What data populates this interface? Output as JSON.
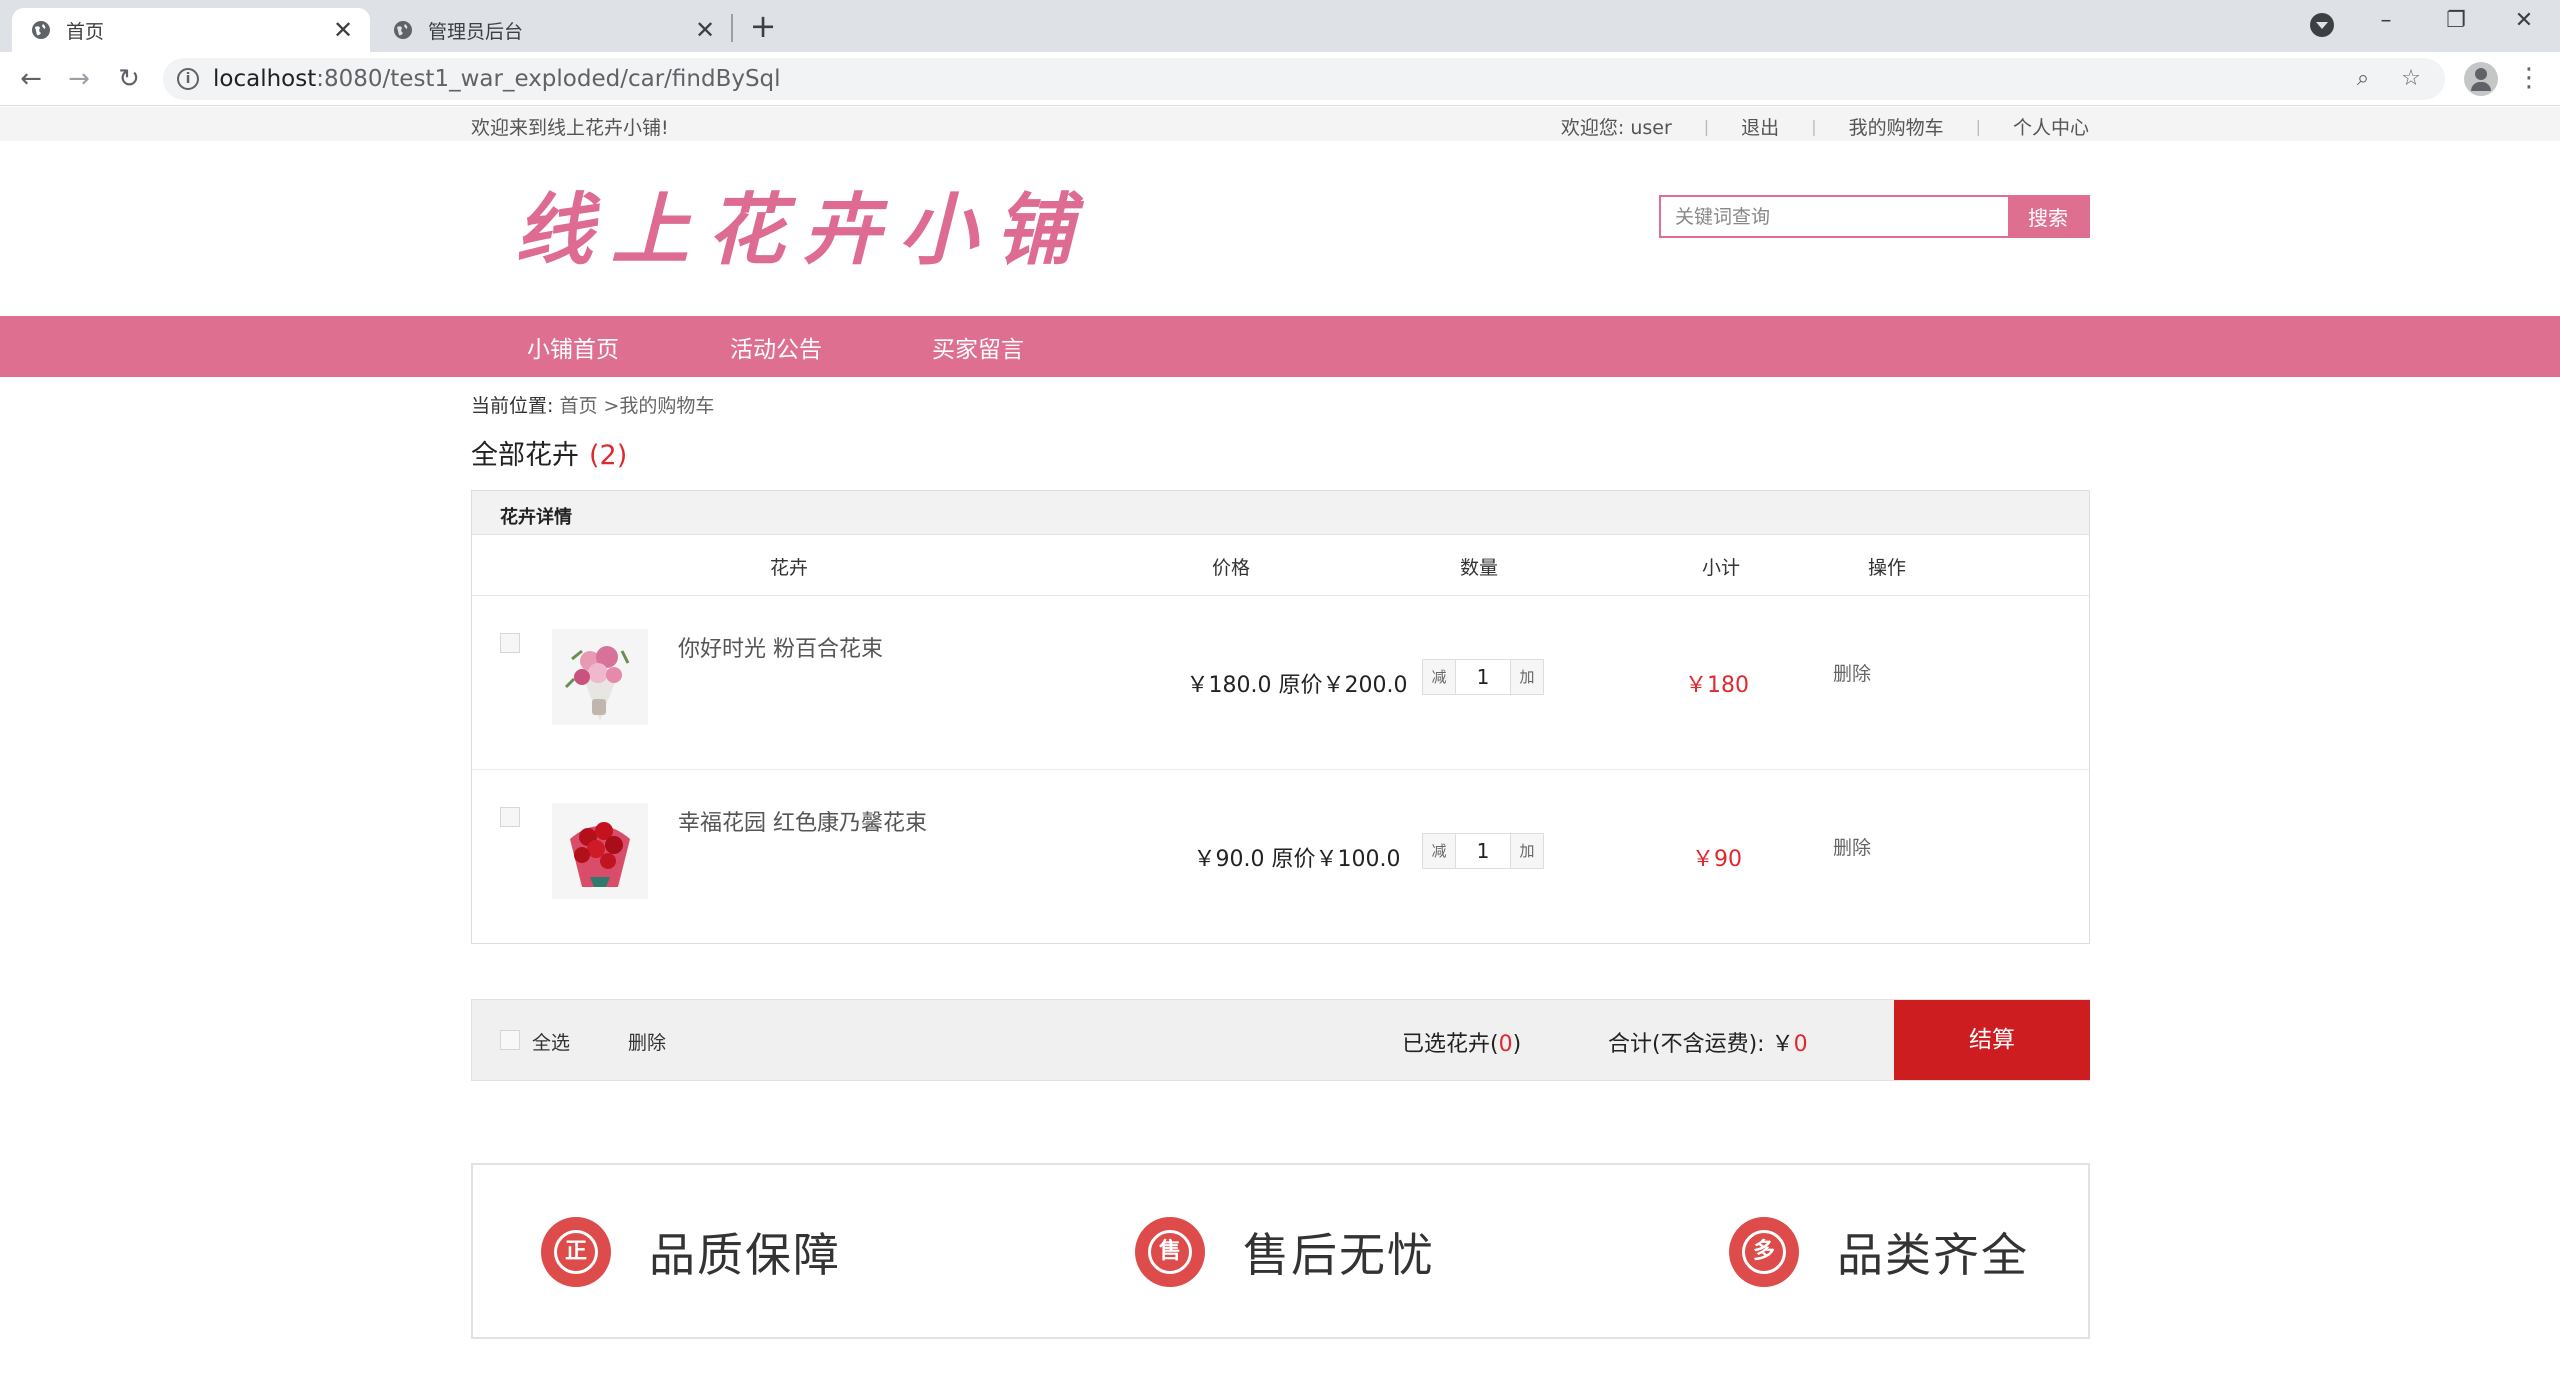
{
  "browser": {
    "tabs": [
      {
        "title": "首页",
        "active": true
      },
      {
        "title": "管理员后台",
        "active": false
      }
    ],
    "url_host": "localhost",
    "url_path": ":8080/test1_war_exploded/car/findBySql",
    "window_controls": {
      "minimize": "–",
      "restore": "❐",
      "close": "✕"
    }
  },
  "topbar": {
    "welcome": "欢迎来到线上花卉小铺!",
    "user_greeting": "欢迎您: user",
    "logout": "退出",
    "my_cart": "我的购物车",
    "profile": "个人中心",
    "separator": "|"
  },
  "header": {
    "logo_text": "线上花卉小铺",
    "search_placeholder": "关键词查询",
    "search_button": "搜索"
  },
  "nav": {
    "items": [
      "小铺首页",
      "活动公告",
      "买家留言"
    ]
  },
  "breadcrumb": {
    "prefix": "当前位置:",
    "home": "首页",
    "current": ">我的购物车"
  },
  "section": {
    "title": "全部花卉",
    "count": "(2)"
  },
  "cart": {
    "header_label": "花卉详情",
    "columns": {
      "flower": "花卉",
      "price": "价格",
      "qty": "数量",
      "subtotal": "小计",
      "action": "操作"
    },
    "items": [
      {
        "name": "你好时光 粉百合花束",
        "price": "￥180.0 原价￥200.0",
        "dec": "减",
        "qty": "1",
        "inc": "加",
        "subtotal": "￥180",
        "delete": "删除",
        "flower_color": "pink"
      },
      {
        "name": "幸福花园 红色康乃馨花束",
        "price": "￥90.0 原价￥100.0",
        "dec": "减",
        "qty": "1",
        "inc": "加",
        "subtotal": "￥90",
        "delete": "删除",
        "flower_color": "red"
      }
    ]
  },
  "summary": {
    "select_all": "全选",
    "delete": "删除",
    "selected_label": "已选花卉",
    "selected_open": "(",
    "selected_count": "0",
    "selected_close": ")",
    "total_label": "合计(不含运费):",
    "total_currency": "￥",
    "total_value": "0",
    "checkout": "结算"
  },
  "guarantees": [
    {
      "icon_char": "正",
      "label": "品质保障",
      "icon": "quality-badge-icon"
    },
    {
      "icon_char": "售",
      "label": "售后无忧",
      "icon": "aftersale-badge-icon"
    },
    {
      "icon_char": "多",
      "label": "品类齐全",
      "icon": "variety-badge-icon"
    }
  ],
  "colors": {
    "brand_pink": "#de6f91",
    "accent_red": "#e0282e",
    "checkout_red": "#cd1d21"
  }
}
